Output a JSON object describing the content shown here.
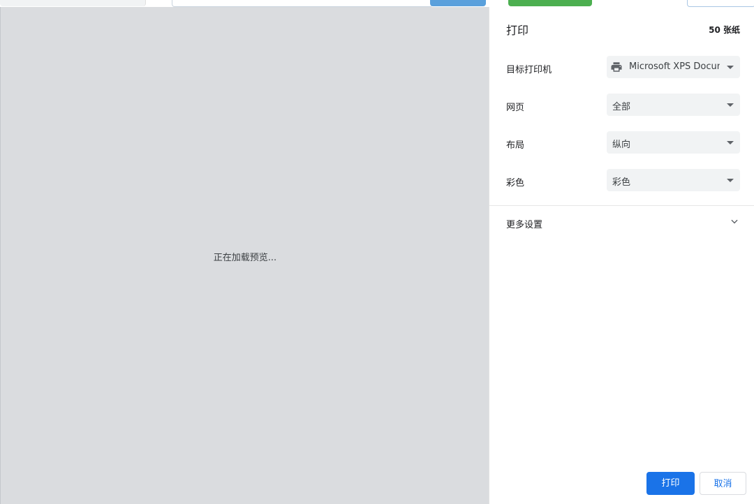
{
  "preview": {
    "loading_text": "正在加载预览..."
  },
  "sidebar": {
    "title": "打印",
    "sheet_count": "50 张纸",
    "settings": [
      {
        "label": "目标打印机",
        "value": "Microsoft XPS Docum",
        "icon": "printer-icon"
      },
      {
        "label": "网页",
        "value": "全部"
      },
      {
        "label": "布局",
        "value": "纵向"
      },
      {
        "label": "彩色",
        "value": "彩色"
      }
    ],
    "more_settings_label": "更多设置"
  },
  "footer": {
    "print_label": "打印",
    "cancel_label": "取消"
  },
  "colors": {
    "accent": "#1a73e8",
    "preview_bg": "#dadcdf",
    "select_bg": "#f1f3f4"
  }
}
